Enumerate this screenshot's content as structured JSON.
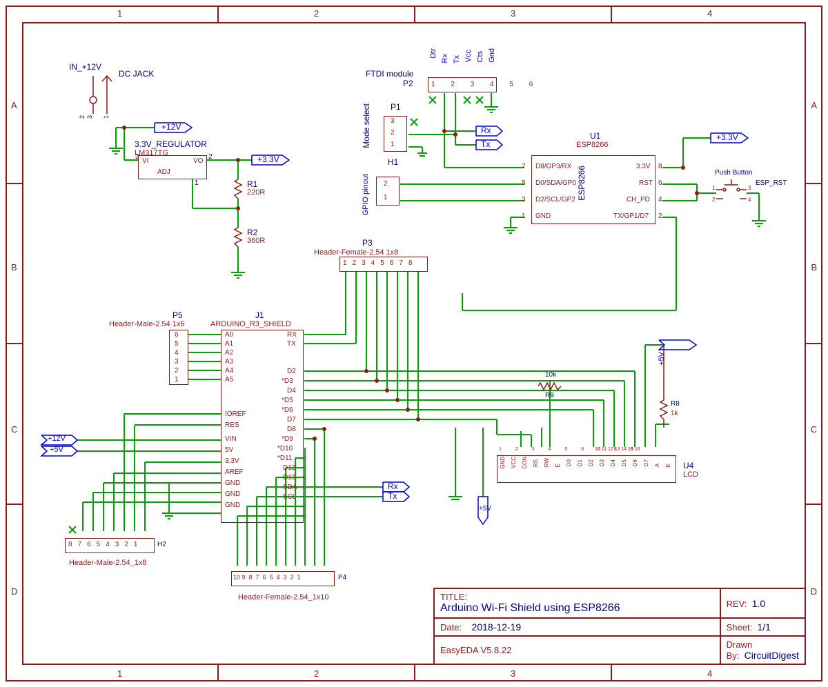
{
  "frame": {
    "cols": [
      "1",
      "2",
      "3",
      "4"
    ],
    "rows": [
      "A",
      "B",
      "C",
      "D"
    ]
  },
  "titleblock": {
    "title_lbl": "TITLE:",
    "title_val": "Arduino Wi-Fi Shield using ESP8266",
    "rev_lbl": "REV:",
    "rev_val": "1.0",
    "date_lbl": "Date:",
    "date_val": "2018-12-19",
    "sheet_lbl": "Sheet:",
    "sheet_val": "1/1",
    "tool": "EasyEDA V5.8.22",
    "drawn_lbl": "Drawn By:",
    "drawn_val": "CircuitDigest"
  },
  "power": {
    "jack_ref": "IN_+12V",
    "jack_name": "DC JACK",
    "reg_ref": "3.3V_REGULATOR",
    "reg_name": "LM317TG",
    "vi": "VI",
    "vo": "VO",
    "adj": "ADJ",
    "r1_ref": "R1",
    "r1_val": "220R",
    "r2_ref": "R2",
    "r2_val": "360R",
    "net_12v": "+12V",
    "net_33v": "+3.3V"
  },
  "ftdi": {
    "label": "FTDI module",
    "ref": "P2",
    "pins": [
      "Dtr",
      "Rx",
      "Tx",
      "Vcc",
      "Cts",
      "Gnd"
    ],
    "nums": [
      "1",
      "2",
      "3",
      "4",
      "5",
      "6"
    ],
    "rx": "Rx",
    "tx": "Tx"
  },
  "mode": {
    "label": "Mode select",
    "ref": "P1",
    "pins": [
      "3",
      "2",
      "1"
    ]
  },
  "gpio": {
    "label": "GPIO pinout",
    "ref": "H1",
    "pins": [
      "2",
      "1"
    ]
  },
  "esp": {
    "ref": "U1",
    "name": "ESP8266",
    "left": {
      "7": "D8/GP3/RX",
      "5": "D0/SDA/GP0",
      "3": "D2/SCL/GP2",
      "1": "GND"
    },
    "right": {
      "8": "3.3V",
      "6": "RST",
      "4": "CH_PD",
      "2": "TX/GP1/D7"
    },
    "vert": "ESP8266",
    "net_33v": "+3.3V"
  },
  "button": {
    "label": "Push Button",
    "ref": "ESP_RST",
    "p1": "1",
    "p2": "2",
    "p3": "3",
    "p4": "4"
  },
  "p3": {
    "ref": "P3",
    "name": "Header-Female-2.54  1x8",
    "nums": [
      "1",
      "2",
      "3",
      "4",
      "5",
      "6",
      "7",
      "8"
    ]
  },
  "p4": {
    "ref": "P4",
    "name": "Header-Female-2.54_1x10",
    "nums": [
      "10",
      "9",
      "8",
      "7",
      "6",
      "5",
      "4",
      "3",
      "2",
      "1"
    ]
  },
  "p5": {
    "ref": "P5",
    "name": "Header-Male-2.54  1x6",
    "nums": [
      "6",
      "5",
      "4",
      "3",
      "2",
      "1"
    ]
  },
  "h2": {
    "ref": "H2",
    "name": "Header-Male-2.54_1x8",
    "nums": [
      "8",
      "7",
      "6",
      "5",
      "4",
      "3",
      "2",
      "1"
    ]
  },
  "arduino": {
    "ref": "J1",
    "name": "ARDUINO_R3_SHIELD",
    "left_a": [
      "A0",
      "A1",
      "A2",
      "A3",
      "A4",
      "A5"
    ],
    "left_b": [
      "IOREF",
      "RES",
      "VIN",
      "5V",
      "3.3V",
      "AREF",
      "GND",
      "GND",
      "GND"
    ],
    "right": [
      "RX",
      "TX",
      "",
      "D2",
      "*D3",
      "D4",
      "*D5",
      "*D6",
      "D7",
      "D8",
      "*D9",
      "*D10",
      "*D11",
      "D12",
      "D13",
      "SDA",
      "SCL"
    ],
    "rx": "Rx",
    "tx": "Tx",
    "v12": "+12V",
    "v5": "+5V"
  },
  "lcd": {
    "ref": "U4",
    "name": "LCD",
    "pins": [
      "GND",
      "VCC",
      "CON",
      "RS",
      "RW",
      "E",
      "D0",
      "D1",
      "D2",
      "D3",
      "D4",
      "D5",
      "D6",
      "D7",
      "A",
      "K"
    ],
    "nums": [
      "1",
      "2",
      "3",
      "4",
      "5",
      "6",
      "7",
      "8",
      "9",
      "10",
      "11",
      "12",
      "13",
      "14",
      "15",
      "16"
    ],
    "v5": "+5V",
    "netv5": "+5V"
  },
  "r9": {
    "ref": "R9",
    "val": "10k"
  },
  "r8": {
    "ref": "R8",
    "val": "1k"
  }
}
